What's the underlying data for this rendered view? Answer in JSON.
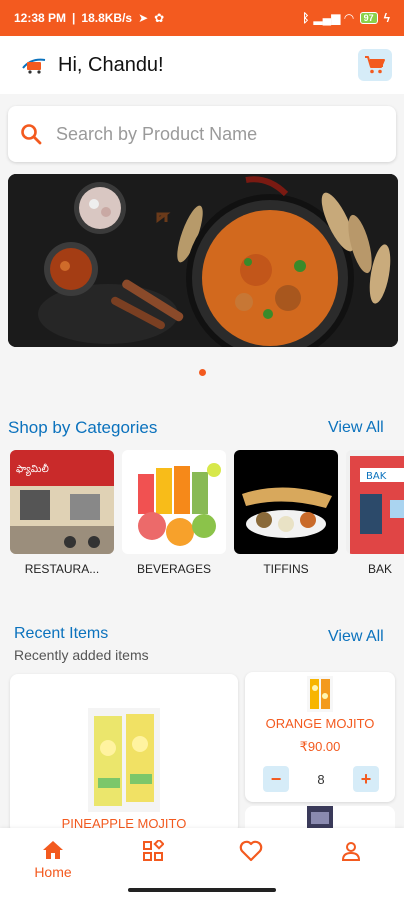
{
  "status_bar": {
    "time": "12:38 PM",
    "speed": "18.8KB/s",
    "battery": "97"
  },
  "header": {
    "greeting": "Hi, Chandu!"
  },
  "search": {
    "placeholder": "Search by Product Name"
  },
  "banner": {
    "active_slide": 1,
    "slide_count": 1
  },
  "categories": {
    "title": "Shop by Categories",
    "view_all": "View All",
    "items": [
      {
        "label": "RESTAURA..."
      },
      {
        "label": "BEVERAGES"
      },
      {
        "label": "TIFFINS"
      },
      {
        "label": "BAK"
      }
    ]
  },
  "recent": {
    "title": "Recent Items",
    "subtitle": "Recently added items",
    "view_all": "View All",
    "items": [
      {
        "name": "PINEAPPLE MOJITO"
      },
      {
        "name": "ORANGE MOJITO",
        "price": "₹90.00",
        "qty": "8"
      }
    ]
  },
  "bottom_nav": {
    "home_label": "Home",
    "active": "home"
  },
  "colors": {
    "accent": "#f35a1f",
    "link": "#0b72bd",
    "chip": "#d6ecf8"
  }
}
